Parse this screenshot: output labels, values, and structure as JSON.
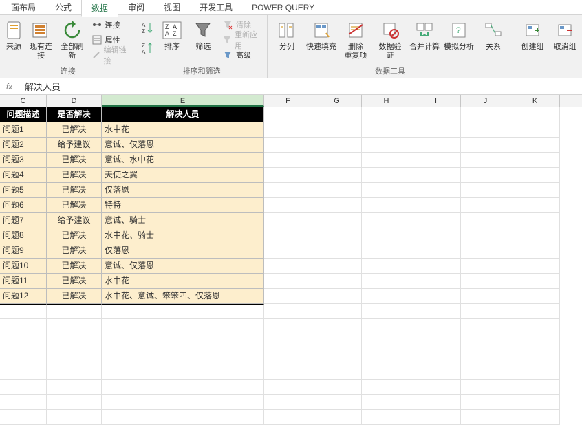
{
  "tabs": {
    "t0": "面布局",
    "t1": "公式",
    "t2": "数据",
    "t3": "审阅",
    "t4": "视图",
    "t5": "开发工具",
    "t6": "POWER QUERY"
  },
  "ribbon": {
    "g1": {
      "b0": "来源",
      "b1": "现有连接",
      "b2": "全部刷新",
      "s0": "连接",
      "s1": "属性",
      "s2": "编辑链接",
      "label": "连接"
    },
    "g2": {
      "b0": "排序",
      "b1": "筛选",
      "s0": "清除",
      "s1": "重新应用",
      "s2": "高级",
      "label": "排序和筛选"
    },
    "g3": {
      "b0": "分列",
      "b1": "快速填充",
      "b2": "删除\n重复项",
      "b3": "数据验\n证",
      "b4": "合并计算",
      "b5": "模拟分析",
      "b6": "关系",
      "label": "数据工具"
    },
    "g4": {
      "b0": "创建组",
      "b1": "取消组"
    }
  },
  "formula": {
    "fx": "fx",
    "value": "解决人员"
  },
  "cols": {
    "C": "C",
    "D": "D",
    "E": "E",
    "F": "F",
    "G": "G",
    "H": "H",
    "I": "I",
    "J": "J",
    "K": "K"
  },
  "headers": {
    "c": "问题描述",
    "d": "是否解决",
    "e": "解决人员"
  },
  "rows": [
    {
      "c": "问题1",
      "d": "已解决",
      "e": "水中花"
    },
    {
      "c": "问题2",
      "d": "给予建议",
      "e": "意诚、仅落恩"
    },
    {
      "c": "问题3",
      "d": "已解决",
      "e": "意诚、水中花"
    },
    {
      "c": "问题4",
      "d": "已解决",
      "e": "天使之翼"
    },
    {
      "c": "问题5",
      "d": "已解决",
      "e": "仅落恩"
    },
    {
      "c": "问题6",
      "d": "已解决",
      "e": "特特"
    },
    {
      "c": "问题7",
      "d": "给予建议",
      "e": "意诚、骑士"
    },
    {
      "c": "问题8",
      "d": "已解决",
      "e": "水中花、骑士"
    },
    {
      "c": "问题9",
      "d": "已解决",
      "e": "仅落恩"
    },
    {
      "c": "问题10",
      "d": "已解决",
      "e": "意诚、仅落恩"
    },
    {
      "c": "问题11",
      "d": "已解决",
      "e": "水中花"
    },
    {
      "c": "问题12",
      "d": "已解决",
      "e": "水中花、意诚、笨笨四、仅落恩"
    }
  ]
}
